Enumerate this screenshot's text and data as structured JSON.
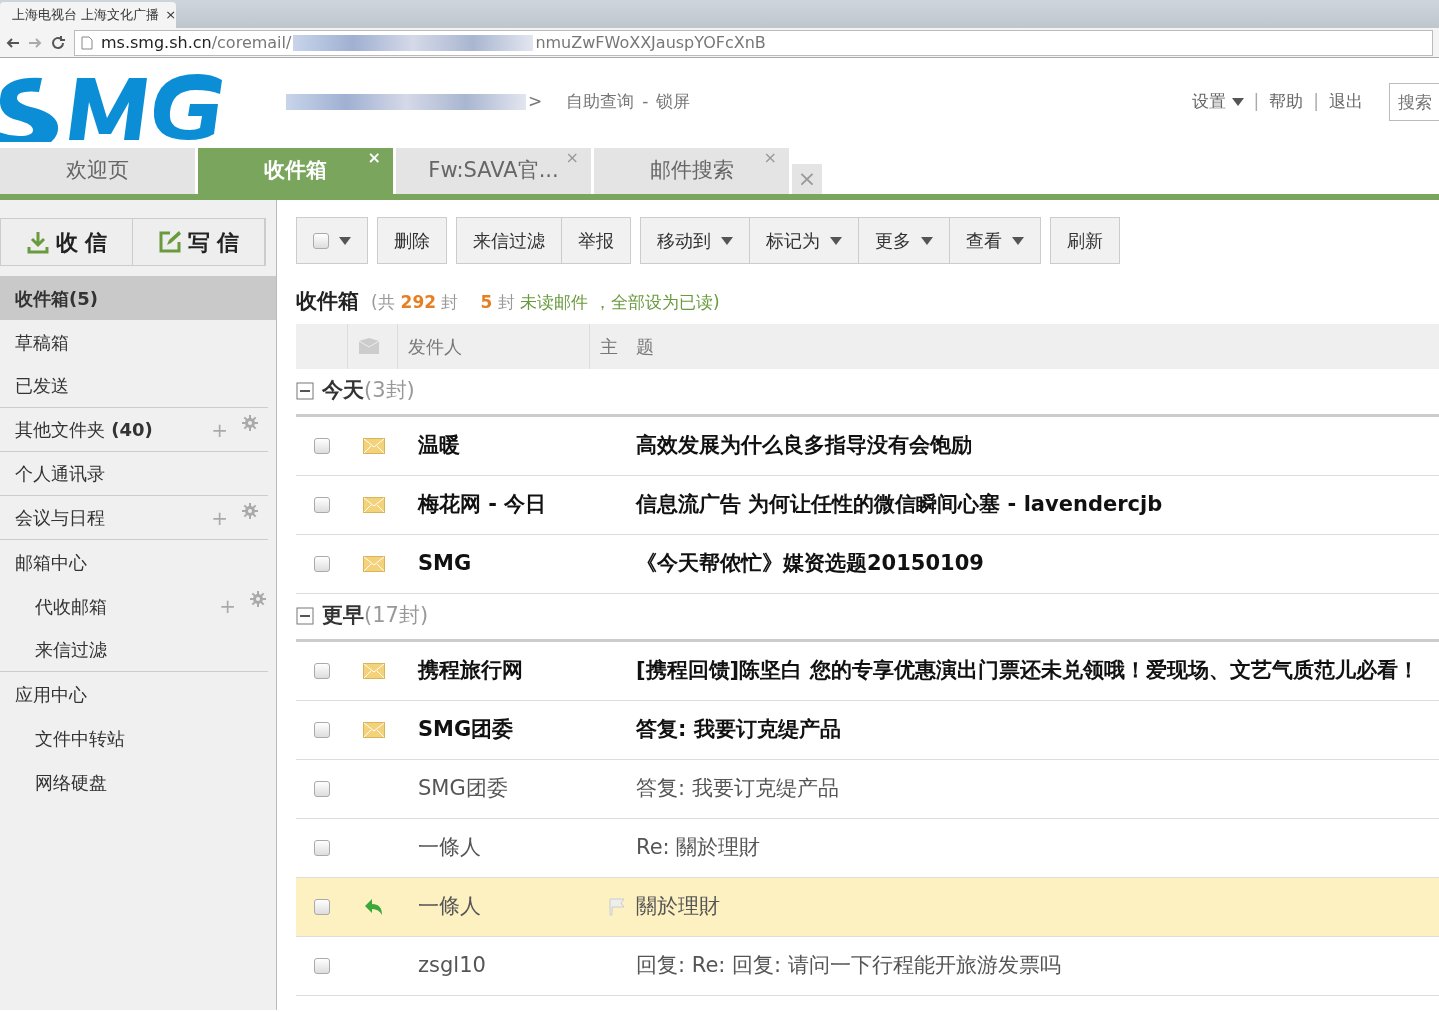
{
  "browser": {
    "tab_title": "上海电视台 上海文化广播",
    "tab_close": "×",
    "url_host": "ms.smg.sh.cn",
    "url_path": "/coremail/",
    "url_tail": "nmuZwFWoXXJauspYOFcXnB"
  },
  "header": {
    "user_suffix": ">",
    "links": [
      "自助查询",
      "-",
      "锁屏"
    ],
    "right": [
      {
        "label": "设置",
        "caret": true,
        "kind": "link"
      },
      {
        "label": "|",
        "caret": false,
        "kind": "separator"
      },
      {
        "label": "帮助",
        "caret": false,
        "kind": "link"
      },
      {
        "label": "|",
        "caret": false,
        "kind": "separator"
      },
      {
        "label": "退出",
        "caret": false,
        "kind": "link"
      }
    ],
    "search_placeholder": "搜索"
  },
  "tabs": [
    {
      "label": "欢迎页",
      "selected": false,
      "closable": false
    },
    {
      "label": "收件箱",
      "selected": true,
      "closable": true
    },
    {
      "label": "Fw:SAVA官...",
      "selected": false,
      "closable": true
    },
    {
      "label": "邮件搜索",
      "selected": false,
      "closable": true
    }
  ],
  "close_mark": "×",
  "side_buttons": [
    {
      "label": "收 信",
      "kind": "receive"
    },
    {
      "label": "写 信",
      "kind": "compose"
    }
  ],
  "folder_sections": [
    {
      "items": [
        {
          "label": "收件箱",
          "count": "(5)",
          "selected": true
        },
        {
          "label": "草稿箱",
          "selected": false
        },
        {
          "label": "已发送",
          "selected": false
        }
      ]
    },
    {
      "items": [
        {
          "label": "其他文件夹",
          "count": "(40)",
          "selected": false,
          "add": "+"
        }
      ]
    },
    {
      "items": [
        {
          "label": "个人通讯录",
          "selected": false
        }
      ]
    },
    {
      "items": [
        {
          "label": "会议与日程",
          "selected": false,
          "add": "+"
        }
      ]
    },
    {
      "items": [
        {
          "label": "邮箱中心",
          "selected": false,
          "children": [
            {
              "label": "代收邮箱",
              "selected": false,
              "add": "+"
            },
            {
              "label": "来信过滤",
              "selected": false
            }
          ]
        }
      ]
    },
    {
      "items": [
        {
          "label": "应用中心",
          "selected": false,
          "children": [
            {
              "label": "文件中转站",
              "selected": false
            },
            {
              "label": "网络硬盘",
              "selected": false
            }
          ]
        }
      ]
    }
  ],
  "toolbar": [
    {
      "group": [
        {
          "label": "删除",
          "caret": false
        }
      ]
    },
    {
      "group": [
        {
          "label": "来信过滤",
          "caret": false
        },
        {
          "label": "举报",
          "caret": false
        }
      ]
    },
    {
      "group": [
        {
          "label": "移动到",
          "caret": true
        },
        {
          "label": "标记为",
          "caret": true
        },
        {
          "label": "更多",
          "caret": true
        },
        {
          "label": "查看",
          "caret": true
        }
      ]
    },
    {
      "group": [
        {
          "label": "刷新",
          "caret": false
        }
      ]
    }
  ],
  "summary": {
    "title": "收件箱",
    "open": "(共",
    "total": "292",
    "unit": "封",
    "unread": "5",
    "unread_unit": "封",
    "unread_label": "未读邮件",
    "mark_all": "，全部设为已读)"
  },
  "columns": [
    "发件人",
    "主　题"
  ],
  "groups": [
    {
      "label": "今天",
      "count": "(3封)",
      "expanded": true,
      "mails": [
        {
          "sender": "温暖",
          "subject": "高效发展为什么良多指导没有会饱励",
          "unread": true,
          "kind": "new",
          "flag": false,
          "selected": false,
          "checked": false
        },
        {
          "sender": "梅花网 - 今日",
          "subject": "信息流广告 为何让任性的微信瞬间心塞 - lavendercjb",
          "unread": true,
          "kind": "new",
          "flag": false,
          "selected": false,
          "checked": false
        },
        {
          "sender": "SMG",
          "subject": "《今天帮侬忙》媒资选题20150109",
          "unread": true,
          "kind": "new",
          "flag": false,
          "selected": false,
          "checked": false
        }
      ]
    },
    {
      "label": "更早",
      "count": "(17封)",
      "expanded": true,
      "mails": [
        {
          "sender": "携程旅行网",
          "subject": "[携程回馈]陈坚白 您的专享优惠演出门票还未兑领哦！爱现场、文艺气质范儿必看！",
          "unread": true,
          "kind": "new",
          "flag": false,
          "selected": false,
          "checked": false
        },
        {
          "sender": "SMG团委",
          "subject": "答复: 我要订克缇产品",
          "unread": true,
          "kind": "new",
          "flag": false,
          "selected": false,
          "checked": false
        },
        {
          "sender": "SMG团委",
          "subject": "答复: 我要订克缇产品",
          "unread": false,
          "kind": "read",
          "flag": false,
          "selected": false,
          "checked": false
        },
        {
          "sender": "一條人",
          "subject": "Re: 關於理財",
          "unread": false,
          "kind": "read",
          "flag": false,
          "selected": false,
          "checked": false
        },
        {
          "sender": "一條人",
          "subject": "關於理財",
          "unread": false,
          "kind": "replied",
          "flag": true,
          "selected": true,
          "checked": false
        },
        {
          "sender": "zsgl10",
          "subject": "回复: Re: 回复: 请问一下行程能开旅游发票吗",
          "unread": false,
          "kind": "read",
          "flag": false,
          "selected": false,
          "checked": false
        }
      ]
    }
  ]
}
